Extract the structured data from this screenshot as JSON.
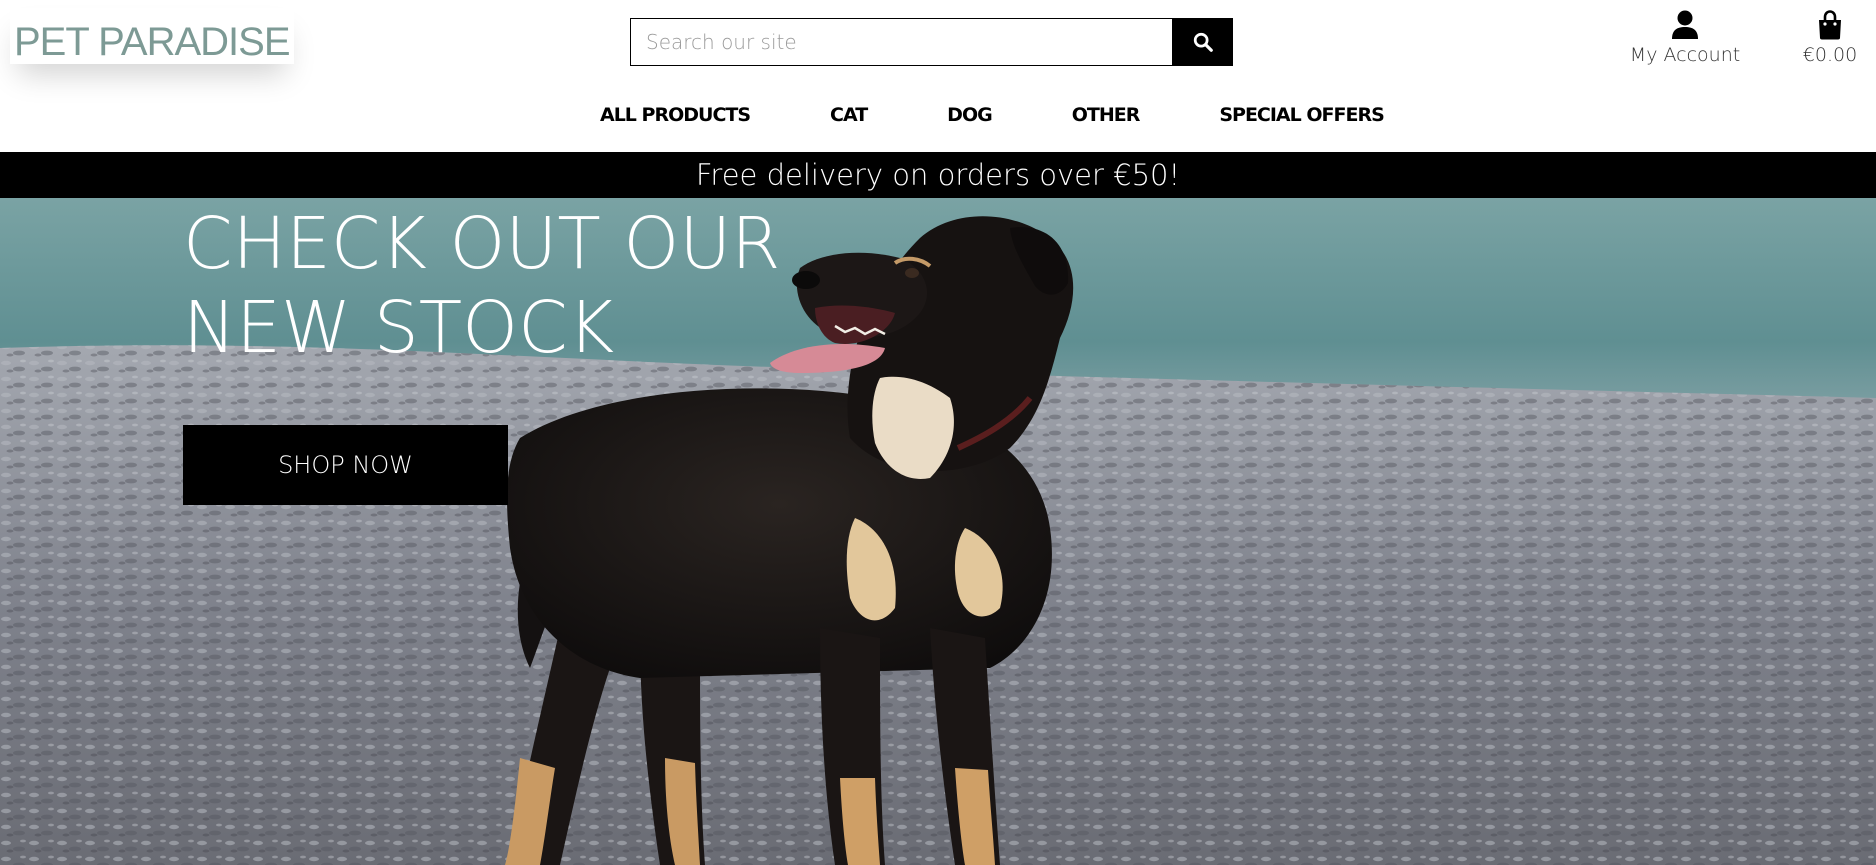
{
  "brand": {
    "logo_text": "PET PARADISE",
    "logo_color": "#7d9a95"
  },
  "search": {
    "placeholder": "Search our site",
    "value": "",
    "icon": "search-icon"
  },
  "account": {
    "label": "My Account",
    "icon": "user-icon"
  },
  "bag": {
    "total": "€0.00",
    "icon": "shopping-bag-icon"
  },
  "nav": {
    "items": [
      {
        "label": "ALL PRODUCTS"
      },
      {
        "label": "CAT"
      },
      {
        "label": "DOG"
      },
      {
        "label": "OTHER"
      },
      {
        "label": "SPECIAL OFFERS"
      }
    ]
  },
  "banner": {
    "text": "Free delivery on orders over €50!"
  },
  "hero": {
    "title_line1": "CHECK OUT OUR",
    "title_line2": "NEW STOCK",
    "button_label": "SHOP NOW"
  },
  "colors": {
    "accent": "#000000",
    "text_on_dark": "#ffffff",
    "water": "#6f9a9c",
    "gravel": "#8f929b"
  }
}
